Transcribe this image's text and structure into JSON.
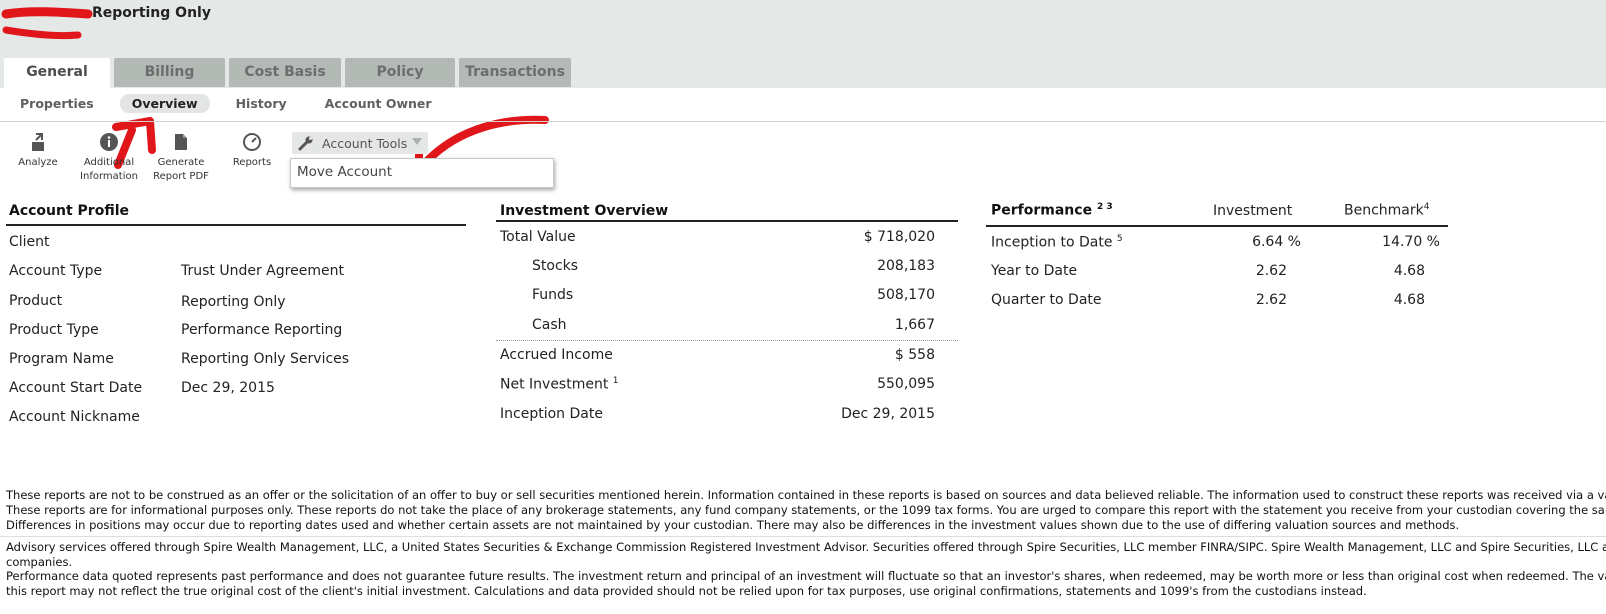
{
  "header": {
    "account_title": "Reporting Only"
  },
  "main_tabs": [
    {
      "label": "General"
    },
    {
      "label": "Billing"
    },
    {
      "label": "Cost Basis"
    },
    {
      "label": "Policy"
    },
    {
      "label": "Transactions"
    }
  ],
  "sub_tabs": [
    {
      "label": "Properties"
    },
    {
      "label": "Overview"
    },
    {
      "label": "History"
    },
    {
      "label": "Account Owner"
    }
  ],
  "toolbar": {
    "analyze": "Analyze",
    "additional_info_1": "Additional",
    "additional_info_2": "Information",
    "generate_1": "Generate",
    "generate_2": "Report PDF",
    "reports": "Reports",
    "account_tools": "Account Tools",
    "menu_move_account": "Move Account"
  },
  "account_profile": {
    "title": "Account Profile",
    "rows": [
      {
        "label": "Client",
        "value": ""
      },
      {
        "label": "Account Type",
        "value": "Trust Under Agreement"
      },
      {
        "label": "Product",
        "value": "Reporting Only"
      },
      {
        "label": "Product Type",
        "value": "Performance Reporting"
      },
      {
        "label": "Program Name",
        "value": "Reporting Only Services"
      },
      {
        "label": "Account Start Date",
        "value": "Dec 29, 2015"
      },
      {
        "label": "Account Nickname",
        "value": ""
      }
    ]
  },
  "investment_overview": {
    "title": "Investment Overview",
    "total_label": "Total Value",
    "total_value": "$ 718,020",
    "stocks_label": "Stocks",
    "stocks_value": "208,183",
    "funds_label": "Funds",
    "funds_value": "508,170",
    "cash_label": "Cash",
    "cash_value": "1,667",
    "accrued_label": "Accrued Income",
    "accrued_value": "$ 558",
    "net_label": "Net Investment",
    "net_sup": "1",
    "net_value": "550,095",
    "inception_label": "Inception Date",
    "inception_value": "Dec 29, 2015"
  },
  "performance": {
    "title": "Performance",
    "title_sup": "2 3",
    "col_investment": "Investment",
    "col_benchmark": "Benchmark",
    "benchmark_sup": "4",
    "rows": [
      {
        "label": "Inception to Date",
        "sup": "5",
        "investment": "6.64 %",
        "benchmark": "14.70 %"
      },
      {
        "label": "Year to Date",
        "sup": "",
        "investment": "2.62",
        "benchmark": "4.68"
      },
      {
        "label": "Quarter to Date",
        "sup": "",
        "investment": "2.62",
        "benchmark": "4.68"
      }
    ]
  },
  "disclaimers": {
    "line1": "These reports are not to be construed as an offer or the solicitation of an offer to buy or sell securities mentioned herein. Information contained in these reports is based on sources and data believed reliable. The information used to construct these reports was received via a variety of sou",
    "line2": "These reports are for informational purposes only. These reports do not take the place of any brokerage statements, any fund company statements, or the 1099 tax forms. You are urged to compare this report with the statement you receive from your custodian covering the same period.",
    "line3": "Differences in positions may occur due to reporting dates used and whether certain assets are not maintained by your custodian. There may also be differences in the investment values shown due to the use of differing valuation sources and methods.",
    "line4": "Advisory services offered through Spire Wealth Management, LLC, a United States Securities & Exchange Commission Registered Investment Advisor. Securities offered through Spire Securities, LLC member FINRA/SIPC. Spire Wealth Management, LLC and Spire Securities, LLC are affiliate",
    "line5": "companies.",
    "line6": "Performance data quoted represents past performance and does not guarantee future results. The investment return and principal of an investment will fluctuate so that an investor's shares, when redeemed, may be worth more or less than original cost when redeemed. The values repre",
    "line7": "this report may not reflect the true original cost of the client's initial investment. Calculations and data provided should not be relied upon for tax purposes, use original confirmations, statements and 1099's from the custodians instead."
  },
  "colors": {
    "annotation_red": "#e0161b",
    "tab_inactive": "#b3bab6",
    "header_bg": "#e4e8e6"
  }
}
